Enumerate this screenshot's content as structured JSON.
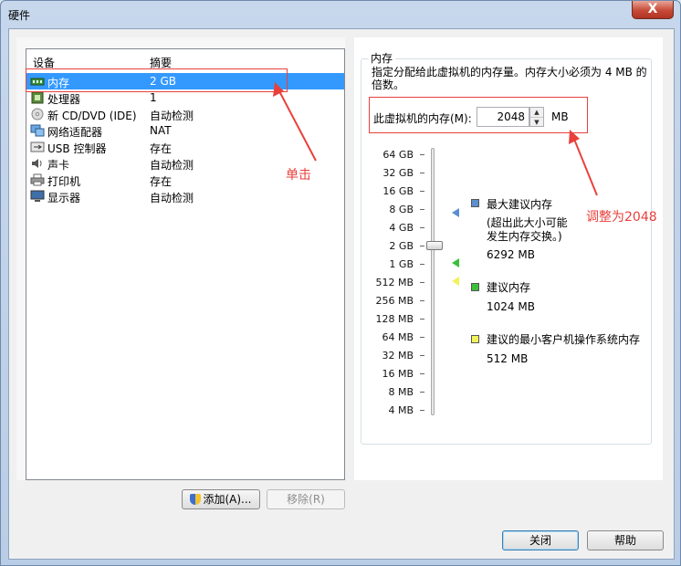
{
  "window": {
    "title": "硬件",
    "close_glyph": "X"
  },
  "devices": {
    "headers": {
      "device": "设备",
      "summary": "摘要"
    },
    "rows": [
      {
        "icon": "memory-icon",
        "name": "内存",
        "summary": "2 GB",
        "selected": true
      },
      {
        "icon": "processor-icon",
        "name": "处理器",
        "summary": "1"
      },
      {
        "icon": "cd-dvd-icon",
        "name": "新 CD/DVD (IDE)",
        "summary": "自动检测"
      },
      {
        "icon": "network-adapter-icon",
        "name": "网络适配器",
        "summary": "NAT"
      },
      {
        "icon": "usb-controller-icon",
        "name": "USB 控制器",
        "summary": "存在"
      },
      {
        "icon": "sound-card-icon",
        "name": "声卡",
        "summary": "自动检测"
      },
      {
        "icon": "printer-icon",
        "name": "打印机",
        "summary": "存在"
      },
      {
        "icon": "display-icon",
        "name": "显示器",
        "summary": "自动检测"
      }
    ],
    "add_button": "添加(A)...",
    "remove_button": "移除(R)"
  },
  "memory": {
    "group_title": "内存",
    "description": "指定分配给此虚拟机的内存量。内存大小必须为 4 MB 的倍数。",
    "field_label": "此虚拟机的内存(M):",
    "value": "2048",
    "unit": "MB",
    "scale": [
      "64 GB",
      "32 GB",
      "16 GB",
      "8 GB",
      "4 GB",
      "2 GB",
      "1 GB",
      "512 MB",
      "256 MB",
      "128 MB",
      "64 MB",
      "32 MB",
      "16 MB",
      "8 MB",
      "4 MB"
    ],
    "slider_value": "2 GB",
    "legend": {
      "max_title": "最大建议内存",
      "max_note_1": "(超出此大小可能",
      "max_note_2": "发生内存交换。)",
      "max_value": "6292 MB",
      "recommended_title": "建议内存",
      "recommended_value": "1024 MB",
      "min_title": "建议的最小客户机操作系统内存",
      "min_value": "512 MB"
    },
    "colors": {
      "max": "#5a8fd0",
      "recommended": "#3bbf3b",
      "min": "#f2f25a"
    }
  },
  "buttons": {
    "close": "关闭",
    "help": "帮助"
  },
  "annotations": {
    "click": "单击",
    "adjust": "调整为2048",
    "color": "#e8413c"
  }
}
